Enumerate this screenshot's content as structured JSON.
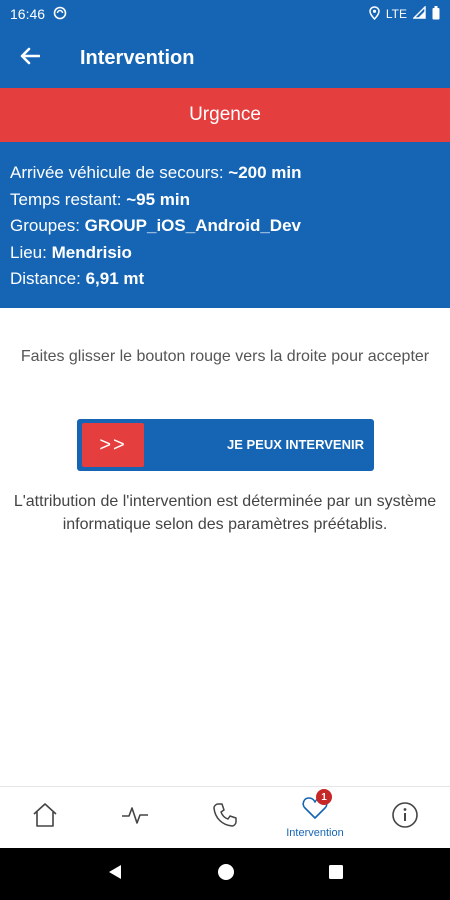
{
  "status_bar": {
    "time": "16:46",
    "network": "LTE",
    "icons": [
      "sync-icon",
      "location-icon",
      "signal-icon",
      "battery-icon"
    ]
  },
  "app_bar": {
    "title": "Intervention",
    "back_icon": "arrow-back-icon"
  },
  "urgence": {
    "label": "Urgence",
    "color": "#e53e3e"
  },
  "info": {
    "arrival_label": "Arrivée véhicule de secours: ",
    "arrival_value": "~200 min",
    "remaining_label": "Temps restant: ",
    "remaining_value": "~95 min",
    "groups_label": "Groupes: ",
    "groups_value": "GROUP_iOS_Android_Dev",
    "place_label": "Lieu: ",
    "place_value": "Mendrisio",
    "distance_label": "Distance: ",
    "distance_value": "6,91 mt"
  },
  "instruction": "Faites glisser le bouton rouge vers la droite pour accepter",
  "slider": {
    "handle_label": ">>",
    "action_label": "JE PEUX INTERVENIR"
  },
  "disclaimer": "L'attribution de l'intervention est déterminée par un système informatique selon des paramètres préétablis.",
  "bottom_nav": {
    "items": [
      {
        "icon": "home-icon",
        "label": ""
      },
      {
        "icon": "pulse-icon",
        "label": ""
      },
      {
        "icon": "phone-icon",
        "label": ""
      },
      {
        "icon": "heart-icon",
        "label": "Intervention",
        "badge": "1"
      },
      {
        "icon": "info-icon",
        "label": ""
      }
    ]
  },
  "colors": {
    "primary": "#1565b4",
    "accent_red": "#e53e3e",
    "badge_red": "#c62828"
  }
}
